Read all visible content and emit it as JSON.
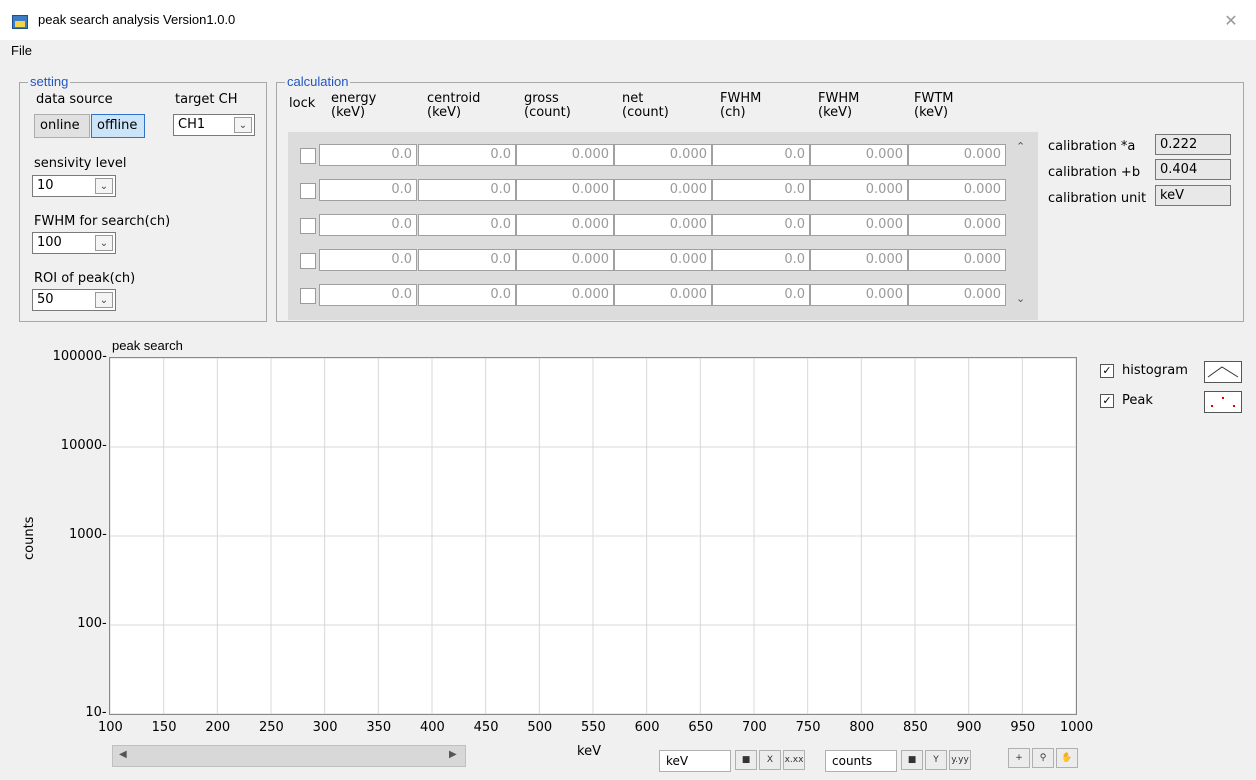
{
  "window": {
    "title": "peak search analysis  Version1.0.0",
    "close": "✕"
  },
  "menu": {
    "file": "File"
  },
  "setting": {
    "title": "setting",
    "data_source_label": "data source",
    "online": "online",
    "offline": "offline",
    "target_ch_label": "target CH",
    "target_ch_value": "CH1",
    "sensitivity_label": "sensivity level",
    "sensitivity_value": "10",
    "fwhm_label": "FWHM for search(ch)",
    "fwhm_value": "100",
    "roi_label": "ROI of peak(ch)",
    "roi_value": "50"
  },
  "calculation": {
    "title": "calculation",
    "headers": {
      "lock": "lock",
      "energy": "energy\n(keV)",
      "centroid": "centroid\n(keV)",
      "gross": "gross\n(count)",
      "net": "net\n(count)",
      "fwhm_ch": "FWHM\n(ch)",
      "fwhm_kev": "FWHM\n(keV)",
      "fwtm_kev": "FWTM\n(keV)"
    },
    "rows": [
      [
        "0.0",
        "0.0",
        "0.000",
        "0.000",
        "0.0",
        "0.000",
        "0.000"
      ],
      [
        "0.0",
        "0.0",
        "0.000",
        "0.000",
        "0.0",
        "0.000",
        "0.000"
      ],
      [
        "0.0",
        "0.0",
        "0.000",
        "0.000",
        "0.0",
        "0.000",
        "0.000"
      ],
      [
        "0.0",
        "0.0",
        "0.000",
        "0.000",
        "0.0",
        "0.000",
        "0.000"
      ],
      [
        "0.0",
        "0.0",
        "0.000",
        "0.000",
        "0.0",
        "0.000",
        "0.000"
      ]
    ],
    "calibration_a_label": "calibration *a",
    "calibration_a_value": "0.222",
    "calibration_b_label": "calibration +b",
    "calibration_b_value": "0.404",
    "calibration_unit_label": "calibration unit",
    "calibration_unit_value": "keV"
  },
  "chart_data": {
    "type": "line",
    "title": "peak search",
    "xlabel": "keV",
    "ylabel": "counts",
    "xlim": [
      100,
      1000
    ],
    "ylim": [
      10,
      100000
    ],
    "y_scale": "log",
    "x_ticks": [
      "100",
      "150",
      "200",
      "250",
      "300",
      "350",
      "400",
      "450",
      "500",
      "550",
      "600",
      "650",
      "700",
      "750",
      "800",
      "850",
      "900",
      "950",
      "1000"
    ],
    "y_ticks": [
      "100000",
      "10000",
      "1000",
      "100",
      "10"
    ],
    "grid": true,
    "legend_placement": "right",
    "series": [
      {
        "name": "histogram",
        "values": []
      },
      {
        "name": "Peak",
        "values": []
      }
    ]
  },
  "legend": {
    "histogram": "histogram",
    "peak": "Peak",
    "check": "✓"
  },
  "axis_controls": {
    "x_unit": "keV",
    "y_unit": "counts"
  },
  "colors": {
    "peak_marker": "#e00000",
    "group_title": "#2155c4",
    "selected_button": "#cce4f7"
  }
}
